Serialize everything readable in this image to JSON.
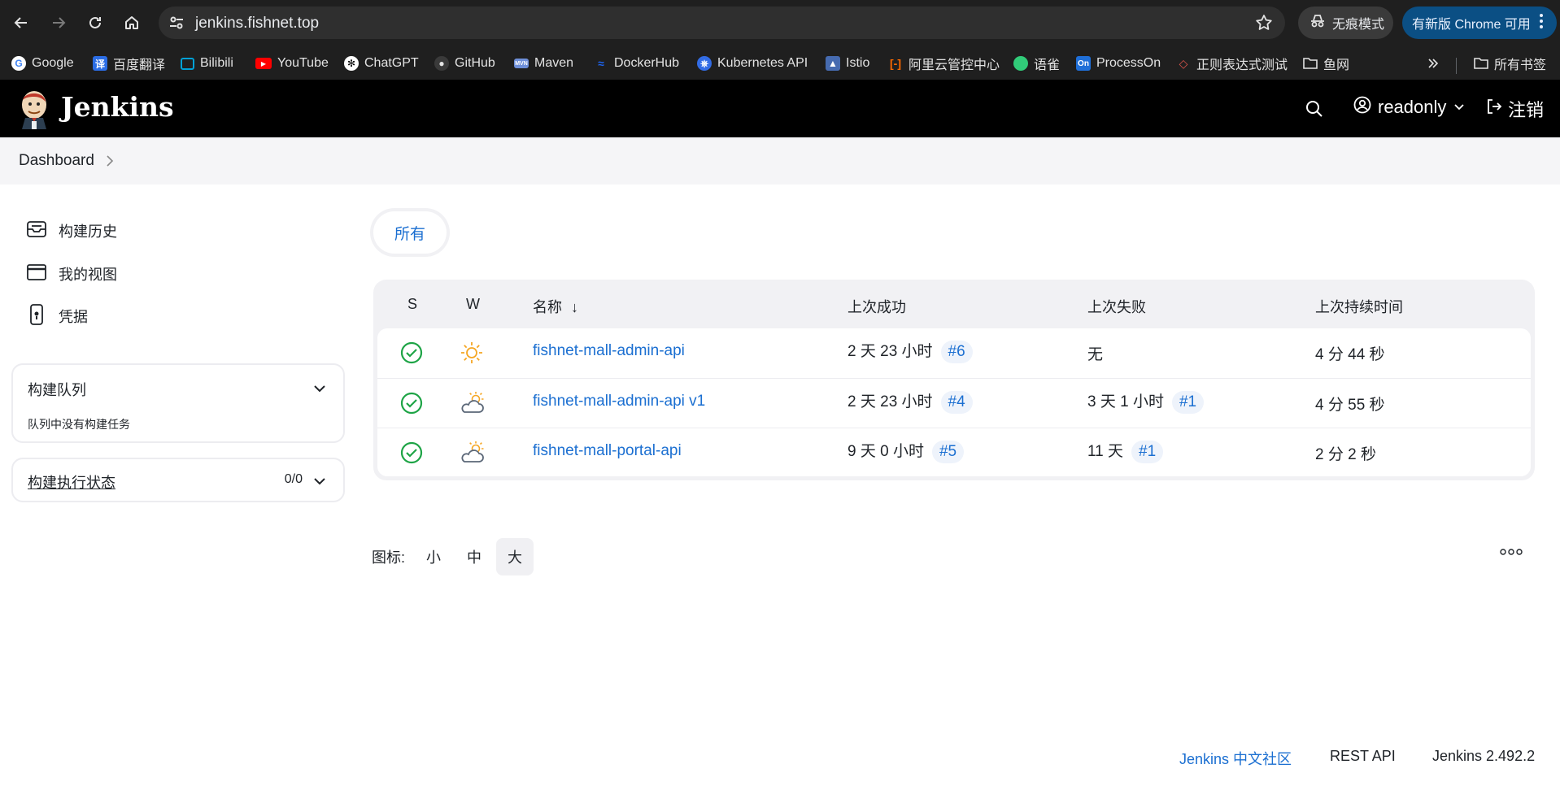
{
  "browser": {
    "url": "jenkins.fishnet.top",
    "incognito_label": "无痕模式",
    "update_label": "有新版 Chrome 可用",
    "bookmarks": [
      {
        "label": "Google",
        "icon": "google-icon",
        "color": "#4285f4"
      },
      {
        "label": "百度翻译",
        "icon": "baidu-translate-icon",
        "color": "#2b6de5"
      },
      {
        "label": "Bilibili",
        "icon": "bilibili-icon",
        "color": "#00a1d6"
      },
      {
        "label": "YouTube",
        "icon": "youtube-icon",
        "color": "#ff0000"
      },
      {
        "label": "ChatGPT",
        "icon": "chatgpt-icon",
        "color": "#ffffff"
      },
      {
        "label": "GitHub",
        "icon": "github-icon",
        "color": "#e3e3e3"
      },
      {
        "label": "Maven",
        "icon": "maven-icon",
        "color": "#6e8fd9"
      },
      {
        "label": "DockerHub",
        "icon": "docker-icon",
        "color": "#1d63ed"
      },
      {
        "label": "Kubernetes API",
        "icon": "kubernetes-icon",
        "color": "#326ce5"
      },
      {
        "label": "Istio",
        "icon": "istio-icon",
        "color": "#466bb0"
      },
      {
        "label": "阿里云管控中心",
        "icon": "aliyun-icon",
        "color": "#ff6a00"
      },
      {
        "label": "语雀",
        "icon": "yuque-icon",
        "color": "#31cc79"
      },
      {
        "label": "ProcessOn",
        "icon": "processon-icon",
        "color": "#1f6fd8"
      },
      {
        "label": "正则表达式测试",
        "icon": "regex-icon",
        "color": "#e0554c"
      },
      {
        "label": "鱼网",
        "icon": "folder-icon",
        "color": "#e3e3e3"
      }
    ],
    "all_bookmarks_label": "所有书签"
  },
  "header": {
    "app_name": "Jenkins",
    "user": "readonly",
    "logout": "注销"
  },
  "breadcrumb": {
    "root": "Dashboard"
  },
  "side": {
    "tasks": [
      {
        "label": "构建历史",
        "icon": "build-history-icon"
      },
      {
        "label": "我的视图",
        "icon": "my-views-icon"
      },
      {
        "label": "凭据",
        "icon": "credentials-icon"
      }
    ],
    "queue": {
      "title": "构建队列",
      "empty": "队列中没有构建任务"
    },
    "executors": {
      "title": "构建执行状态",
      "count": "0/0"
    }
  },
  "main": {
    "tab": "所有",
    "columns": {
      "s": "S",
      "w": "W",
      "name": "名称",
      "sort_arrow": "↓",
      "last_success": "上次成功",
      "last_failure": "上次失败",
      "last_duration": "上次持续时间"
    },
    "jobs": [
      {
        "name": "fishnet-mall-admin-api",
        "status": "success",
        "weather": "sunny-icon",
        "last_success": "2 天 23 小时",
        "success_build": "#6",
        "last_failure": "无",
        "failure_build": "",
        "duration": "4 分 44 秒"
      },
      {
        "name": "fishnet-mall-admin-api v1",
        "status": "success",
        "weather": "partly-cloudy-icon",
        "last_success": "2 天 23 小时",
        "success_build": "#4",
        "last_failure": "3 天 1 小时",
        "failure_build": "#1",
        "duration": "4 分 55 秒"
      },
      {
        "name": "fishnet-mall-portal-api",
        "status": "success",
        "weather": "partly-cloudy-icon",
        "last_success": "9 天 0 小时",
        "success_build": "#5",
        "last_failure": "11 天",
        "failure_build": "#1",
        "duration": "2 分 2 秒"
      }
    ],
    "icon_size": {
      "label": "图标:",
      "small": "小",
      "medium": "中",
      "large": "大",
      "selected": "大"
    }
  },
  "footer": {
    "community": "Jenkins 中文社区",
    "rest_api": "REST API",
    "version": "Jenkins 2.492.2"
  },
  "colors": {
    "accent": "#1b6fd1",
    "success": "#1ea446",
    "sun": "#f5a623"
  }
}
